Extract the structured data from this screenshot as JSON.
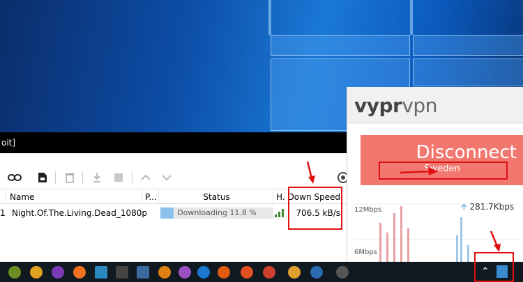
{
  "qbittorrent": {
    "title_fragment": "oit]",
    "columns": {
      "name": "Name",
      "priority": "P...",
      "status": "Status",
      "health": "H.",
      "down_speed": "Down Speed"
    },
    "rows": [
      {
        "index": "1",
        "name": "Night.Of.The.Living.Dead_1080p",
        "status": "Downloading 11.8 %",
        "progress": 0.118,
        "down_speed": "706.5 kB/s"
      }
    ]
  },
  "vyprvpn": {
    "brand_bold": "vypr",
    "brand_light": "vpn",
    "disconnect_label": "Disconnect",
    "location": "Sweden",
    "graph": {
      "y_label_top": "12Mbps",
      "y_label_mid": "6Mbps",
      "upload_speed": "281.7Kbps"
    }
  },
  "colors": {
    "disconnect_bg": "#f2776f",
    "annotation": "#e01010",
    "progress_fill": "#8ec1ee"
  }
}
